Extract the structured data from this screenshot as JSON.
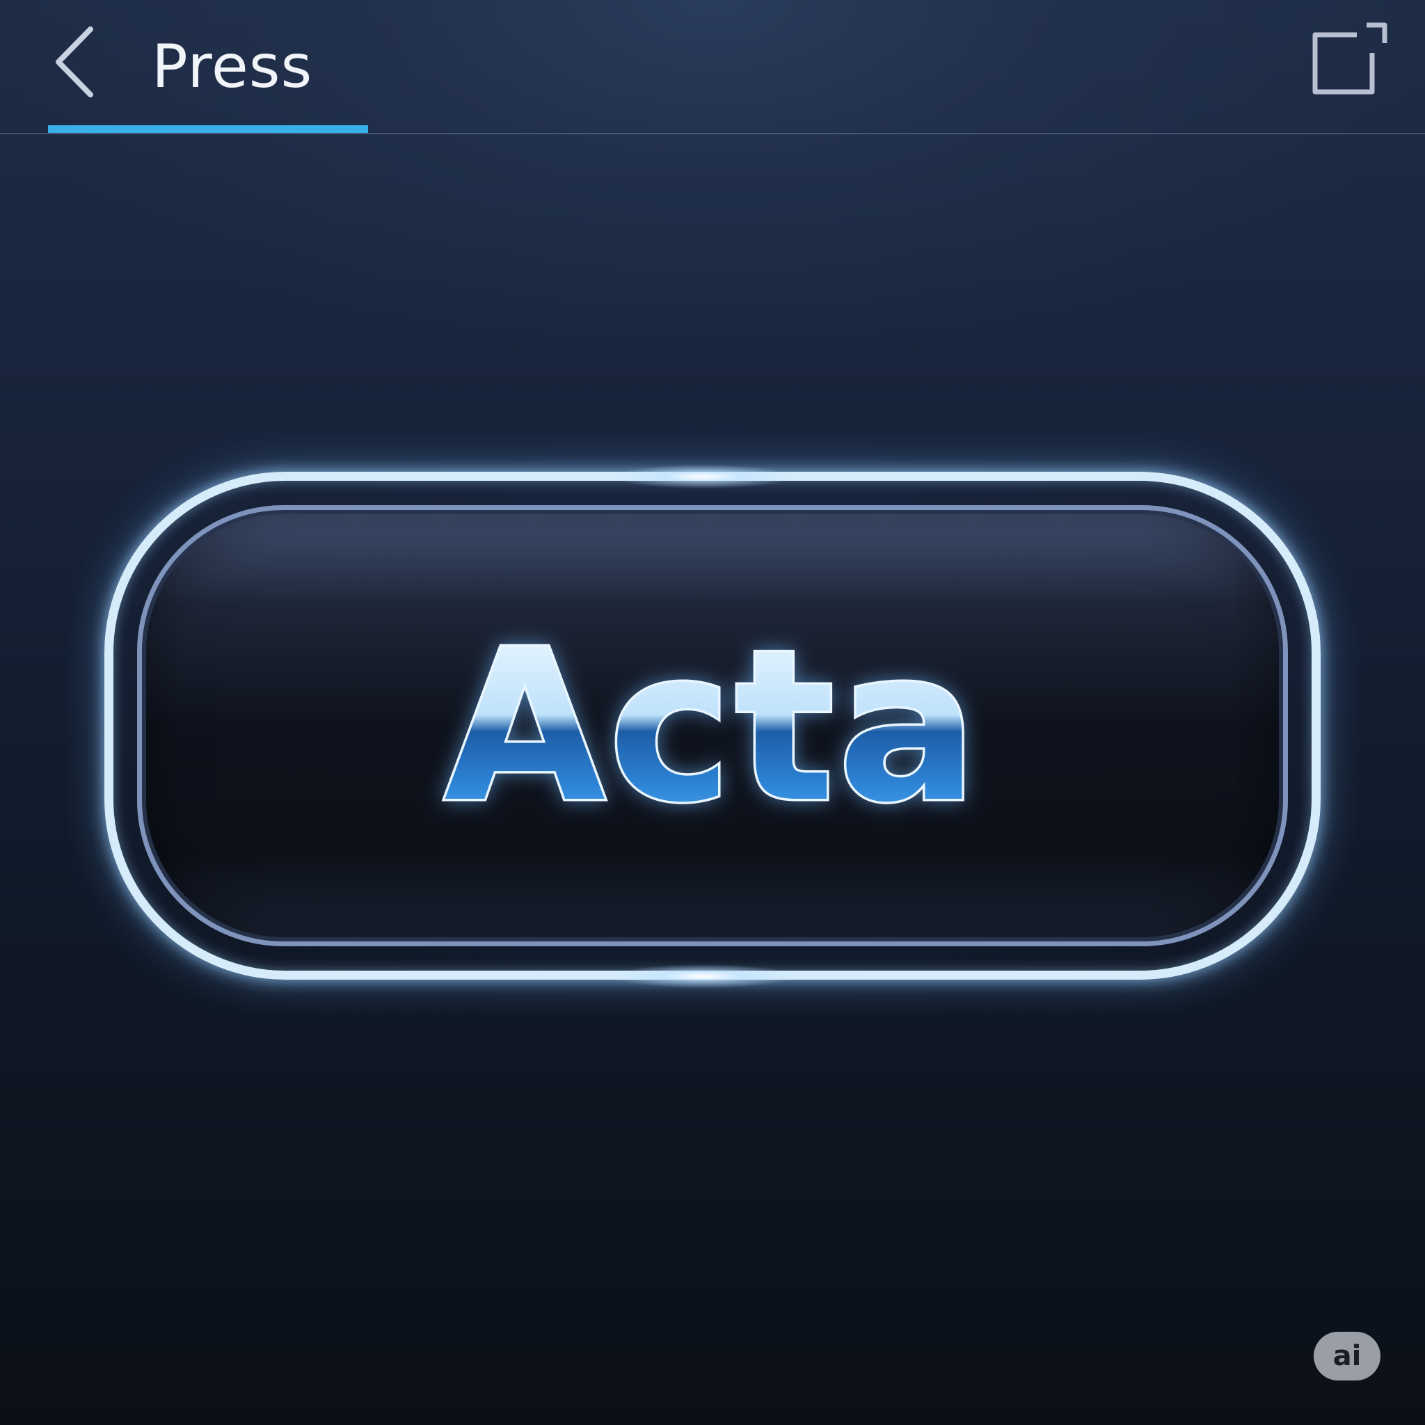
{
  "header": {
    "title": "Press",
    "back_icon": "chevron-left-icon",
    "expand_icon": "expand-icon"
  },
  "main_button": {
    "label": "Acta"
  },
  "badge": {
    "label": "ai"
  },
  "colors": {
    "accent": "#3ab0ea",
    "button_outline": "#d6ecfb",
    "label_fill_top": "#e8f6ff",
    "label_fill_bottom": "#3f9fea"
  }
}
